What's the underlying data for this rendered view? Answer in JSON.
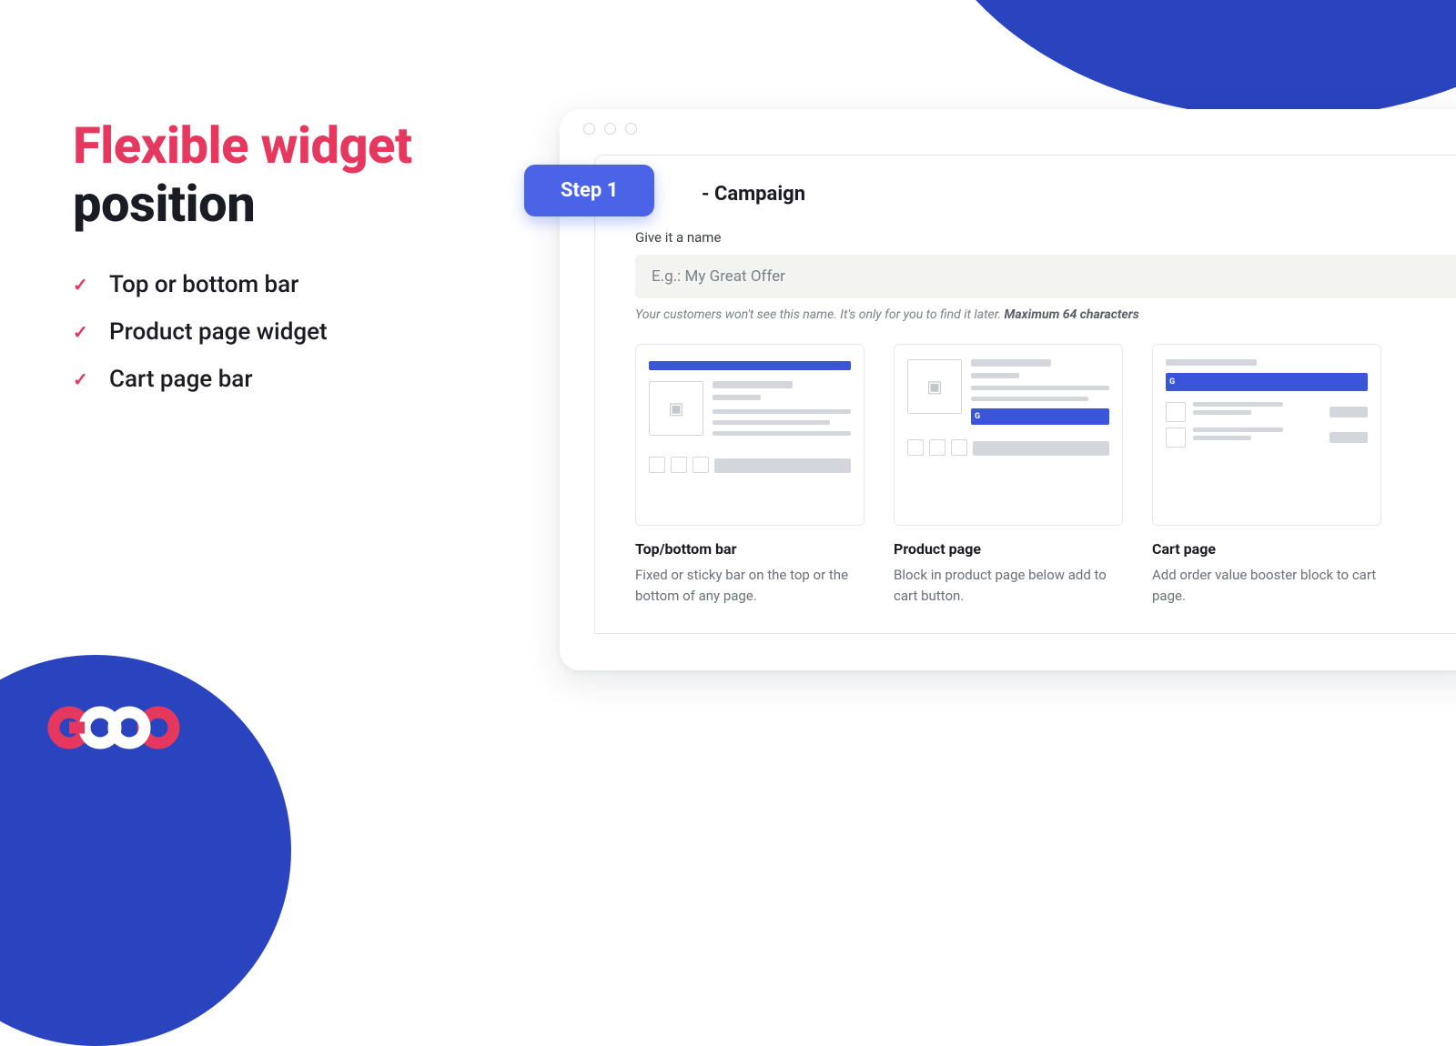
{
  "headline": {
    "line1": "Flexible widget",
    "line2": "position"
  },
  "bullets": [
    "Top or bottom bar",
    "Product page widget",
    "Cart page bar"
  ],
  "step": {
    "chip": "Step 1",
    "suffix": "- Campaign"
  },
  "form": {
    "label": "Give it a name",
    "placeholder": "E.g.: My Great Offer",
    "hint_plain": "Your customers won't see this name. It's only for you to find it later. ",
    "hint_bold": "Maximum 64 characters"
  },
  "options": [
    {
      "title": "Top/bottom bar",
      "desc": "Fixed or sticky bar on the top or the bottom of any page."
    },
    {
      "title": "Product page",
      "desc": "Block in product page below add to cart button."
    },
    {
      "title": "Cart page",
      "desc": "Add order value booster block to cart page."
    }
  ],
  "logo_text": "GOOO"
}
